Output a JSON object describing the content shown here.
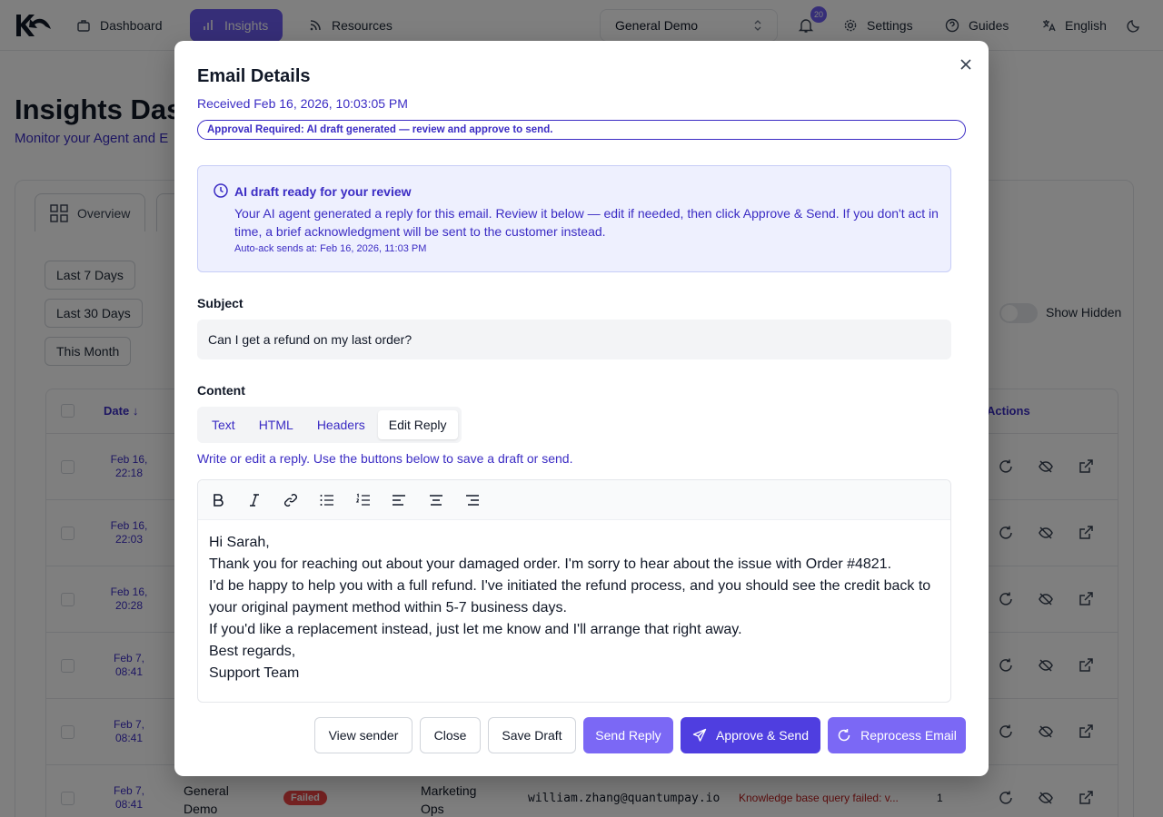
{
  "nav": {
    "items": [
      {
        "label": "Dashboard"
      },
      {
        "label": "Insights"
      },
      {
        "label": "Resources"
      }
    ],
    "workspace": "General Demo",
    "notification_count": "20",
    "settings": "Settings",
    "guides": "Guides",
    "language": "English"
  },
  "page": {
    "title": "Insights Dash",
    "subtitle": "Monitor your Agent and E",
    "tab_overview": "Overview",
    "ranges": [
      "Last 7 Days",
      "Last 30 Days",
      "This Month"
    ],
    "show_hidden": "Show Hidden",
    "col_date": "Date",
    "col_actions": "Actions",
    "rows": [
      {
        "date": "Feb 16,\n22:18"
      },
      {
        "date": "Feb 16,\n22:03"
      },
      {
        "date": "Feb 16,\n20:28"
      },
      {
        "date": "Feb 7,\n08:41"
      },
      {
        "date": "Feb 7,\n08:41"
      },
      {
        "date": "Feb 7,\n08:41",
        "workspace": "General\nDemo",
        "status": "Failed",
        "team": "Marketing\nOps",
        "email": "william.zhang@quantumpay.io",
        "error": "Knowledge base query failed: v...",
        "count": "1"
      }
    ],
    "colors": {
      "accent": "#6d5cf0",
      "link": "#3b2cc4",
      "failed": "#ef4444"
    }
  },
  "modal": {
    "title": "Email Details",
    "received": "Received Feb 16, 2026, 10:03:05 PM",
    "approval": "Approval Required: AI draft generated — review and approve to send.",
    "info_title": "AI draft ready for your review",
    "info_body": "Your AI agent generated a reply for this email. Review it below — edit if needed, then click Approve & Send. If you don't act in time, a brief acknowledgment will be sent to the customer instead.",
    "info_foot": "Auto-ack sends at: Feb 16, 2026, 11:03 PM",
    "subject_label": "Subject",
    "subject": "Can I get a refund on my last order?",
    "content_label": "Content",
    "tabs": [
      {
        "label": "Text"
      },
      {
        "label": "HTML"
      },
      {
        "label": "Headers"
      },
      {
        "label": "Edit Reply"
      }
    ],
    "hint": "Write or edit a reply. Use the buttons below to save a draft or send.",
    "body_lines": [
      "Hi Sarah,",
      "Thank you for reaching out about your damaged order. I'm sorry to hear about the issue with Order #4821.",
      "I'd be happy to help you with a full refund. I've initiated the refund process, and you should see the credit back to your original payment method within 5-7 business days.",
      "If you'd like a replacement instead, just let me know and I'll arrange that right away.",
      "Best regards,",
      "Support Team"
    ],
    "buttons": {
      "view_sender": "View sender",
      "close": "Close",
      "save_draft": "Save Draft",
      "send_reply": "Send Reply",
      "approve_send": "Approve & Send",
      "reprocess": "Reprocess Email"
    }
  }
}
